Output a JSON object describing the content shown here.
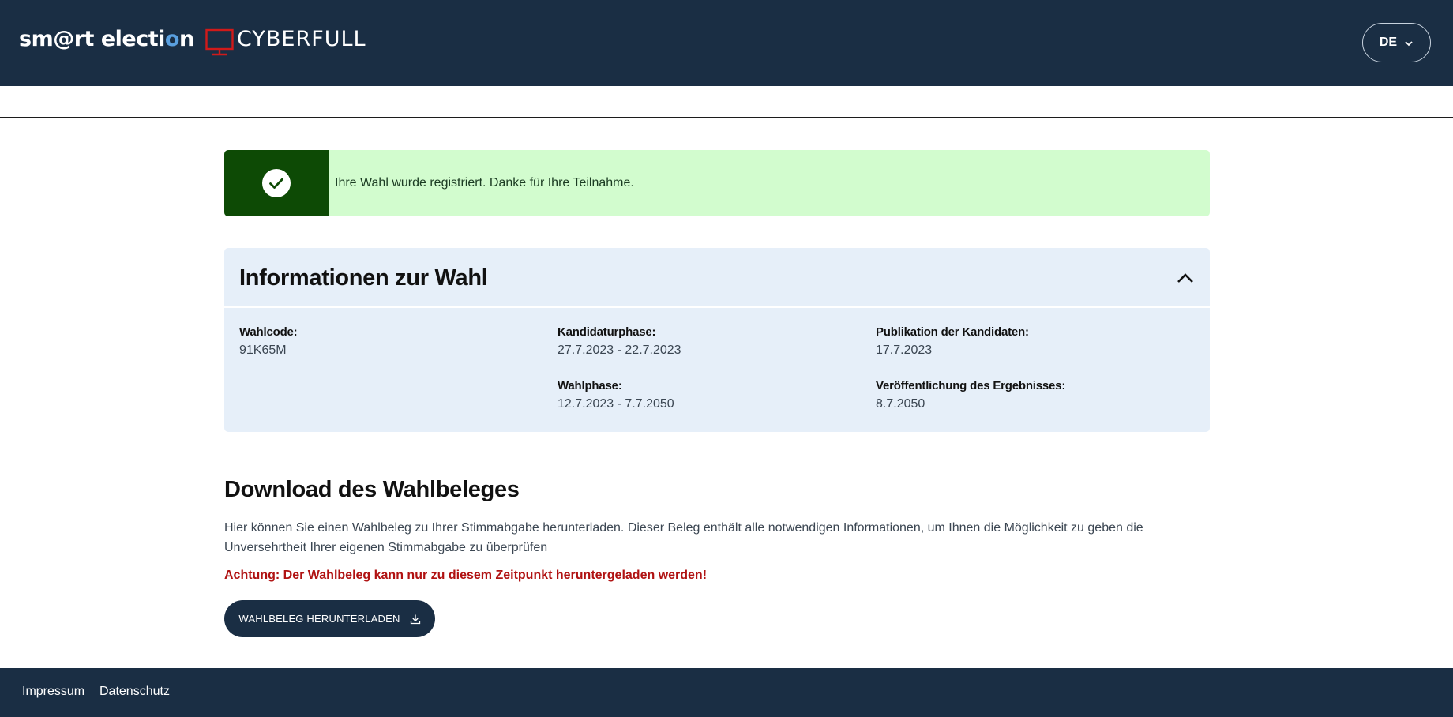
{
  "header": {
    "brand_prefix": "sm@rt electi",
    "brand_mark": "o",
    "brand_suffix": "n",
    "partner_name": "CYBERFULL",
    "partner_icon": "monitor-icon",
    "language": "DE",
    "language_icon": "chevron-down-icon",
    "brand_accent_color": "#5aa0e0",
    "partner_icon_color": "#d01a1a"
  },
  "alert": {
    "icon": "check-circle-icon",
    "message": "Ihre Wahl wurde registriert. Danke für Ihre Teilnahme.",
    "background_color": "#d2fcce",
    "icon_background_color": "#0d4a05"
  },
  "info": {
    "title": "Informationen zur Wahl",
    "toggle_icon": "chevron-up-icon",
    "items": [
      {
        "label": "Wahlcode:",
        "value": "91K65M"
      },
      {
        "label": "Kandidaturphase:",
        "value": "27.7.2023 - 22.7.2023"
      },
      {
        "label": "Publikation der Kandidaten:",
        "value": "17.7.2023"
      },
      {
        "label": "Wahlphase:",
        "value": "12.7.2023 - 7.7.2050"
      },
      {
        "label": "Veröffentlichung des Ergebnisses:",
        "value": "8.7.2050"
      }
    ]
  },
  "download": {
    "title": "Download des Wahlbeleges",
    "description": "Hier können Sie einen Wahlbeleg zu Ihrer Stimmabgabe herunterladen. Dieser Beleg enthält alle notwendigen Informationen, um Ihnen die Möglichkeit zu geben die Unversehrtheit Ihrer eigenen Stimmabgabe zu überprüfen",
    "warning": "Achtung: Der Wahlbeleg kann nur zu diesem Zeitpunkt heruntergeladen werden!",
    "button_label": "WAHLBELEG HERUNTERLADEN",
    "button_icon": "download-icon",
    "warning_color": "#b01212"
  },
  "footer": {
    "links": [
      "Impressum",
      "Datenschutz"
    ]
  },
  "colors": {
    "header_background": "#1a2e44",
    "info_background": "#e6eff9"
  }
}
